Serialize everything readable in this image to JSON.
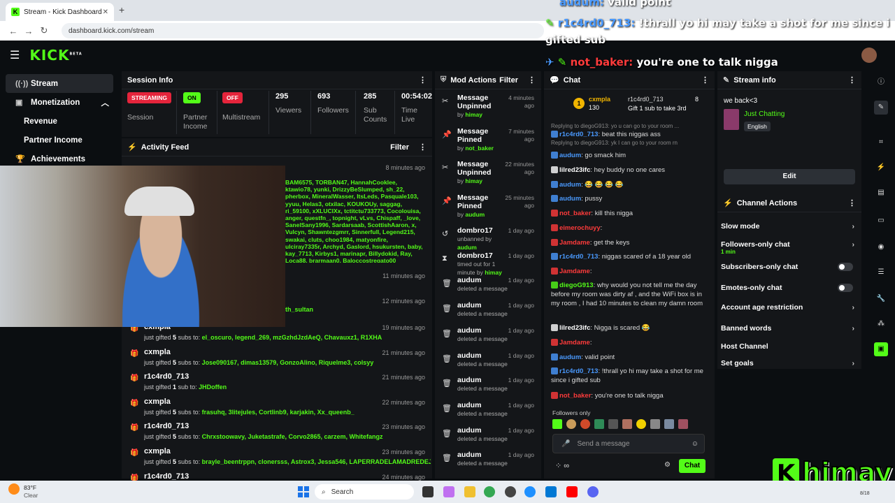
{
  "browser": {
    "tab_title": "Stream - Kick Dashboard",
    "url": "dashboard.kick.com/stream"
  },
  "kick": {
    "logo": "KICK",
    "logo_sup": "BETA"
  },
  "sidebar": {
    "items": [
      {
        "label": "Stream"
      },
      {
        "label": "Monetization"
      },
      {
        "label": "Revenue"
      },
      {
        "label": "Partner Income"
      },
      {
        "label": "Achievements"
      }
    ]
  },
  "session": {
    "title": "Session Info",
    "status_badge": "STREAMING",
    "status_label": "Session",
    "partner_badge": "ON",
    "partner_label": "Partner Income",
    "multistream_badge": "OFF",
    "multistream_label": "Multistream",
    "viewers": "295",
    "viewers_label": "Viewers",
    "followers": "693",
    "followers_label": "Followers",
    "subs": "285",
    "subs_label": "Sub Counts",
    "time": "00:54:02",
    "time_label": "Time Live"
  },
  "activity": {
    "title": "Activity Feed",
    "filter": "Filter",
    "top_time": "8 minutes ago",
    "overlay_names": "BAM6575, TORBAN47, HannahCooklee, ktawio78, yunki, DrizzyBeSlumped, sh_22, pherbox, MineralWasser, ItsLeds, Pasquale103, yyuu, Helas3, otxilac, KOUKOUy, saggag, ri_59100, xXLUCIXx, tctitctu733773, Cocolouisa, anger, questfn_, topnight, vLvs, Chispaff, _love, SanelSany1996, Sardarsaab, ScottishAaron, x, Vulcyn, Shawntezgmrr, Sinnerfull, Legend215, swakai, cluts, choo1984, matyonfire, ulciray7335r, Archyd, Gaslord, hsukursten, baby, kay_7713, Kirbys1, marinapr, Billydokid, Ray, Loca88, brarmaan0, Baloccostregato00",
    "time_11": "11 minutes ago",
    "time_12": "12 minutes ago",
    "partial_name": "th_sultan",
    "rows": [
      {
        "name": "cxmpla",
        "prefix": "just gifted",
        "count": "5",
        "suffix": "subs to:",
        "recipients": "el_oscuro, legend_269, mzGzhdJzdAeQ, Chavauxz1, R1XHA",
        "time": "19 minutes ago"
      },
      {
        "name": "cxmpla",
        "prefix": "just gifted",
        "count": "5",
        "suffix": "subs to:",
        "recipients": "Jose090167, dimas13579, GonzoAlino, Riquelme3, colsyy",
        "time": "21 minutes ago"
      },
      {
        "name": "r1c4rd0_713",
        "prefix": "just gifted",
        "count": "1",
        "suffix": "sub to:",
        "recipients": "JHDoffen",
        "time": "21 minutes ago"
      },
      {
        "name": "cxmpla",
        "prefix": "just gifted",
        "count": "5",
        "suffix": "subs to:",
        "recipients": "frasuhq, 3litejules, Cortlinb9, karjakin, Xx_queenb_",
        "time": "22 minutes ago"
      },
      {
        "name": "r1c4rd0_713",
        "prefix": "just gifted",
        "count": "5",
        "suffix": "subs to:",
        "recipients": "Chrxstoowavy, Juketastrafe, Corvo2865, carzem, Whitefangz",
        "time": "23 minutes ago"
      },
      {
        "name": "cxmpla",
        "prefix": "just gifted",
        "count": "5",
        "suffix": "subs to:",
        "recipients": "brayle_beentrppn, clonersss, Astrox3, Jessa546, LAPERRADELAMADREDEJEMARI",
        "time": "23 minutes ago"
      },
      {
        "name": "r1c4rd0_713",
        "prefix": "",
        "count": "",
        "suffix": "",
        "recipients": "",
        "time": "24 minutes ago"
      }
    ]
  },
  "mod": {
    "title": "Mod Actions",
    "filter": "Filter",
    "rows": [
      {
        "icon": "unpin",
        "title": "Message Unpinned",
        "by": "by",
        "who": "himay",
        "time": "4 minutes ago"
      },
      {
        "icon": "pin",
        "title": "Message Pinned",
        "by": "by",
        "who": "not_baker",
        "time": "7 minutes ago"
      },
      {
        "icon": "unpin",
        "title": "Message Unpinned",
        "by": "by",
        "who": "himay",
        "time": "22 minutes ago"
      },
      {
        "icon": "pin",
        "title": "Message Pinned",
        "by": "by",
        "who": "audum",
        "time": "25 minutes ago"
      },
      {
        "icon": "unban",
        "title": "dombro17",
        "by": "unbanned by",
        "who": "audum",
        "time": "1 day ago"
      },
      {
        "icon": "timeout",
        "title": "dombro17",
        "by": "timed out for 1 minute by",
        "who": "himay",
        "time": "1 day ago"
      },
      {
        "icon": "trash",
        "title": "audum",
        "by": "deleted a message",
        "who": "",
        "time": "1 day ago"
      },
      {
        "icon": "trash",
        "title": "audum",
        "by": "deleted a message",
        "who": "",
        "time": "1 day ago"
      },
      {
        "icon": "trash",
        "title": "audum",
        "by": "deleted a message",
        "who": "",
        "time": "1 day ago"
      },
      {
        "icon": "trash",
        "title": "audum",
        "by": "deleted a message",
        "who": "",
        "time": "1 day ago"
      },
      {
        "icon": "trash",
        "title": "audum",
        "by": "deleted a message",
        "who": "",
        "time": "1 day ago"
      },
      {
        "icon": "trash",
        "title": "audum",
        "by": "deleted a message",
        "who": "",
        "time": "1 day ago"
      },
      {
        "icon": "trash",
        "title": "audum",
        "by": "deleted a message",
        "who": "",
        "time": "1 day ago"
      },
      {
        "icon": "trash",
        "title": "audum",
        "by": "deleted a message",
        "who": "",
        "time": "1 day ago"
      }
    ]
  },
  "chat": {
    "title": "Chat",
    "pinned_user": "cxmpla",
    "pinned_count": "130",
    "pinned_user2": "r1c4rd0_713",
    "pinned_count2": "8",
    "pinned_msg": "Gift 1 sub to take 3rd",
    "reply1": "Replying to diegoG913: yo u can go to your room ...",
    "reply2": "Replying to diegoG913: yk I can go to your room rn",
    "messages": [
      {
        "user": "r1c4rd0_713",
        "color": "#4a9aff",
        "text": "beat this niggas ass"
      },
      {
        "user": "audum",
        "color": "#4a9aff",
        "text": "go smack him"
      },
      {
        "user": "lilred23ifc",
        "color": "#ffffff",
        "text": "hey buddy no one cares"
      },
      {
        "user": "audum",
        "color": "#4a9aff",
        "text": "😂 😂 😂 😂"
      },
      {
        "user": "audum",
        "color": "#4a9aff",
        "text": "pussy"
      },
      {
        "user": "not_baker",
        "color": "#ff3b3b",
        "text": "kill this nigga"
      },
      {
        "user": "eimerochuyy",
        "color": "#ff3b3b",
        "text": ""
      },
      {
        "user": "Jamdame",
        "color": "#ff3b3b",
        "text": "get the keys"
      },
      {
        "user": "r1c4rd0_713",
        "color": "#4a9aff",
        "text": "niggas scared of a 18 year old"
      },
      {
        "user": "Jamdame",
        "color": "#ff3b3b",
        "text": ""
      },
      {
        "user": "diegoG913",
        "color": "#53fc18",
        "text": "why would you not tell me the day before my room was dirty af , and the WiFi box is in my room , I had 10 minutes to clean my damn room"
      },
      {
        "user": "lilred23ifc",
        "color": "#ffffff",
        "text": "Nigga is scared 😂"
      },
      {
        "user": "Jamdame",
        "color": "#ff3b3b",
        "text": ""
      },
      {
        "user": "audum",
        "color": "#4a9aff",
        "text": "valid point"
      },
      {
        "user": "r1c4rd0_713",
        "color": "#4a9aff",
        "text": "!thrall yo hi may take a shot for me since i gifted sub"
      },
      {
        "user": "not_baker",
        "color": "#ff3b3b",
        "text": "you're one to talk nigga"
      }
    ],
    "followers_only": "Followers only",
    "input_placeholder": "Send a message",
    "chat_button": "Chat"
  },
  "stream_info": {
    "title": "Stream info",
    "stream_title": "we back<3",
    "category": "Just Chatting",
    "language": "English",
    "edit": "Edit"
  },
  "channel_actions": {
    "title": "Channel Actions",
    "items": [
      {
        "label": "Slow mode",
        "kind": "chevron"
      },
      {
        "label": "Followers-only chat",
        "sub": "1 min",
        "kind": "chevron"
      },
      {
        "label": "Subscribers-only chat",
        "kind": "toggle"
      },
      {
        "label": "Emotes-only chat",
        "kind": "toggle"
      },
      {
        "label": "Account age restriction",
        "kind": "chevron"
      },
      {
        "label": "Banned words",
        "kind": "chevron"
      },
      {
        "label": "Host Channel",
        "kind": "none"
      },
      {
        "label": "Set goals",
        "kind": "chevron"
      }
    ]
  },
  "overlay": {
    "line0_user": "audum:",
    "line0_text": "valid point",
    "line1_user": "r1c4rd0_713:",
    "line1_text": "!thrall yo hi may take a shot for me since i",
    "line1_text2": "gifted sub",
    "line2_user": "not_baker:",
    "line2_text": "you're one to talk nigga",
    "brand": "himay"
  },
  "taskbar": {
    "temp": "83°F",
    "weather": "Clear",
    "search": "Search",
    "date": "8/18"
  }
}
